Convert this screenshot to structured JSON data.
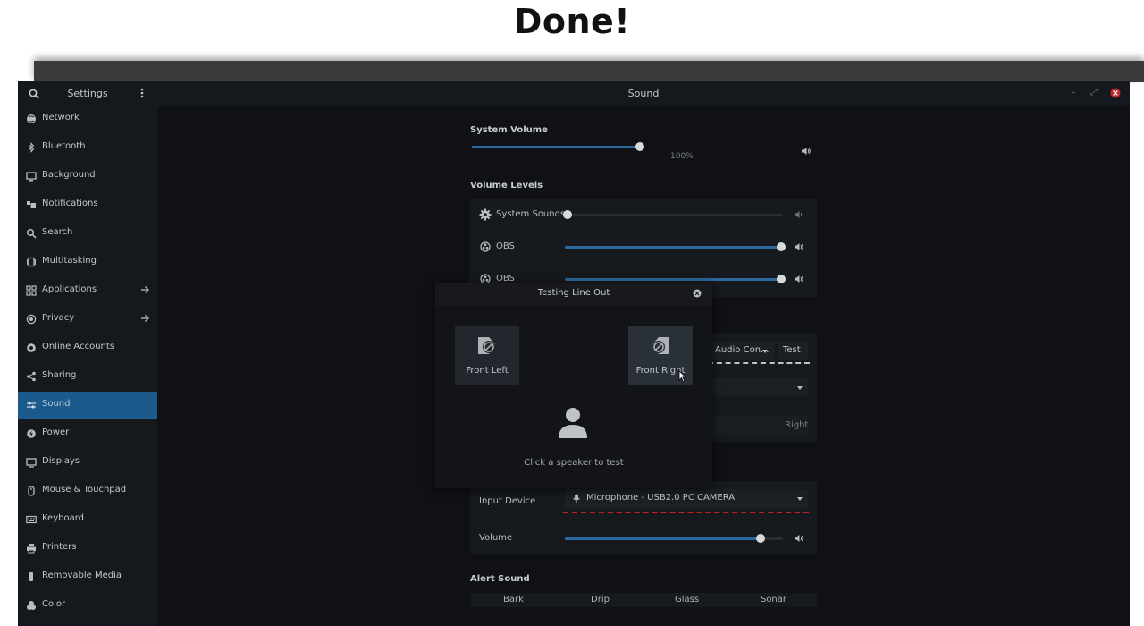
{
  "heading": "Done!",
  "window": {
    "sidebar_title": "Settings",
    "main_title": "Sound",
    "controls": [
      "–",
      "⤢",
      "✕"
    ]
  },
  "sidebar": {
    "items": [
      {
        "label": "Network",
        "icon": "network-icon",
        "arrow": false,
        "active": false
      },
      {
        "label": "Bluetooth",
        "icon": "bluetooth-icon",
        "arrow": false,
        "active": false
      },
      {
        "label": "Background",
        "icon": "background-icon",
        "arrow": false,
        "active": false
      },
      {
        "label": "Notifications",
        "icon": "notifications-icon",
        "arrow": false,
        "active": false
      },
      {
        "label": "Search",
        "icon": "search-icon",
        "arrow": false,
        "active": false
      },
      {
        "label": "Multitasking",
        "icon": "multitasking-icon",
        "arrow": false,
        "active": false
      },
      {
        "label": "Applications",
        "icon": "applications-icon",
        "arrow": true,
        "active": false
      },
      {
        "label": "Privacy",
        "icon": "privacy-icon",
        "arrow": true,
        "active": false
      },
      {
        "label": "Online Accounts",
        "icon": "online-accounts-icon",
        "arrow": false,
        "active": false
      },
      {
        "label": "Sharing",
        "icon": "sharing-icon",
        "arrow": false,
        "active": false
      },
      {
        "label": "Sound",
        "icon": "sound-icon",
        "arrow": false,
        "active": true
      },
      {
        "label": "Power",
        "icon": "power-icon",
        "arrow": false,
        "active": false
      },
      {
        "label": "Displays",
        "icon": "displays-icon",
        "arrow": false,
        "active": false
      },
      {
        "label": "Mouse & Touchpad",
        "icon": "mouse-icon",
        "arrow": false,
        "active": false
      },
      {
        "label": "Keyboard",
        "icon": "keyboard-icon",
        "arrow": false,
        "active": false
      },
      {
        "label": "Printers",
        "icon": "printers-icon",
        "arrow": false,
        "active": false
      },
      {
        "label": "Removable Media",
        "icon": "removable-media-icon",
        "arrow": false,
        "active": false
      },
      {
        "label": "Color",
        "icon": "color-icon",
        "arrow": false,
        "active": false
      }
    ]
  },
  "sound": {
    "system_volume": {
      "title": "System Volume",
      "value_label": "100%",
      "level": 0.45
    },
    "volume_levels": {
      "title": "Volume Levels",
      "rows": [
        {
          "label": "System Sounds",
          "level": 0.0
        },
        {
          "label": "OBS",
          "level": 1.0
        },
        {
          "label": "OBS",
          "level": 1.0
        }
      ]
    },
    "output": {
      "device_partial": "Audio Con...",
      "test_label": "Test",
      "balance_right": "Right"
    },
    "input": {
      "device_label": "Input Device",
      "device_value": "Microphone - USB2.0 PC CAMERA",
      "volume_label": "Volume",
      "level": 0.9
    },
    "alert": {
      "title": "Alert Sound",
      "options": [
        "Bark",
        "Drip",
        "Glass",
        "Sonar"
      ]
    }
  },
  "dialog": {
    "title": "Testing Line Out",
    "speakers": [
      {
        "label": "Front Left"
      },
      {
        "label": "Front Right"
      }
    ],
    "hint": "Click a speaker to test"
  },
  "colors": {
    "accent": "#1b5a8c",
    "slider": "#2b6a9e",
    "error_underline": "#c81e1e"
  }
}
